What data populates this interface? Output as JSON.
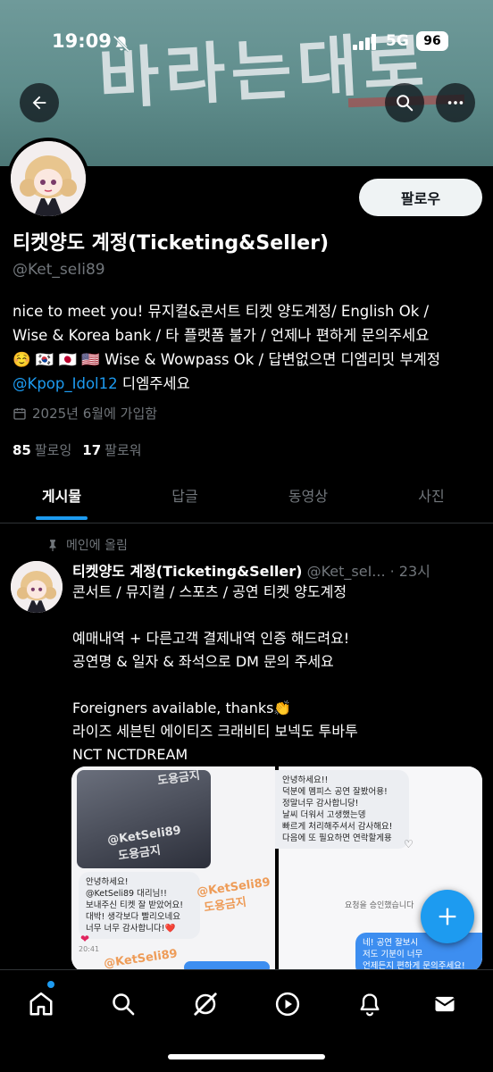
{
  "status_bar": {
    "time": "19:09",
    "network": "5G",
    "battery": "96"
  },
  "banner": {
    "text": "바라는대로"
  },
  "profile": {
    "follow_label": "팔로우",
    "display_name": "티켓양도 계정(Ticketing&Seller)",
    "handle": "@Ket_seIi89",
    "bio_line1": "nice to meet you! 뮤지컬&콘서트 티켓 양도계정/ English Ok /",
    "bio_line2": "Wise & Korea bank / 타 플랫폼 불가 / 언제나 편하게 문의주세요",
    "bio_line3": "☺️  🇰🇷 🇯🇵 🇺🇸 Wise & Wowpass Ok / 답변없으면 디엠리밋 부계정",
    "bio_mention": "@Kpop_Idol12",
    "bio_line4_rest": " 디엠주세요",
    "joined": "2025년 6월에 가입함",
    "following_count": "85",
    "following_label": "팔로잉",
    "followers_count": "17",
    "followers_label": "팔로워"
  },
  "tabs": [
    "게시물",
    "답글",
    "동영상",
    "사진"
  ],
  "post": {
    "pinned_label": "메인에 올림",
    "author_name": "티켓양도 계정(Ticketing&Seller)",
    "author_meta": " @Ket_seI... · 23시",
    "lines": [
      "콘서트 / 뮤지컬 / 스포츠 / 공연 티켓 양도계정",
      "",
      "예매내역 + 다른고객 결제내역 인증 해드려요!",
      "공연명 & 일자 & 좌석으로 DM 문의 주세요",
      "",
      "Foreigners available, thanks👏",
      "라이즈 세븐틴 에이티즈 크래비티 보넥도 투바투",
      "NCT NCTDREAM"
    ]
  },
  "media": {
    "watermark1": "@KetSeli89",
    "watermark1_sub": "도용금지",
    "watermark2": "@KetSeli89",
    "watermark2_sub": "도용금지",
    "watermark_top": "도용금지",
    "chat_left": "안녕하세요!\n@KetSeli89 대리님!!\n보내주신 티켓 잘 받았어요!\n대박! 생각보다 빨리오네요\n너무 너무 감사합니다!❤️",
    "chat_time": "20:41",
    "watermark3": "@KetSeli89",
    "chat_right1": "안녕하세요!!\n덕분에 멤피스 공연 잘봤어용!\n정말너무 감사합니당!\n날씨 더워서 고생했는뎅\n빠르게 처리해주셔서 감사해요!\n다음에 또 필요하면 연락할게용",
    "approved": "요청을 승인했습니다",
    "chat_right2": "네! 공연 잘보시\n저도 기분이 너무\n언제든지 편하게 문의주세요!"
  },
  "colors": {
    "accent": "#1d9bf0",
    "background": "#000000",
    "muted": "#71767b"
  }
}
